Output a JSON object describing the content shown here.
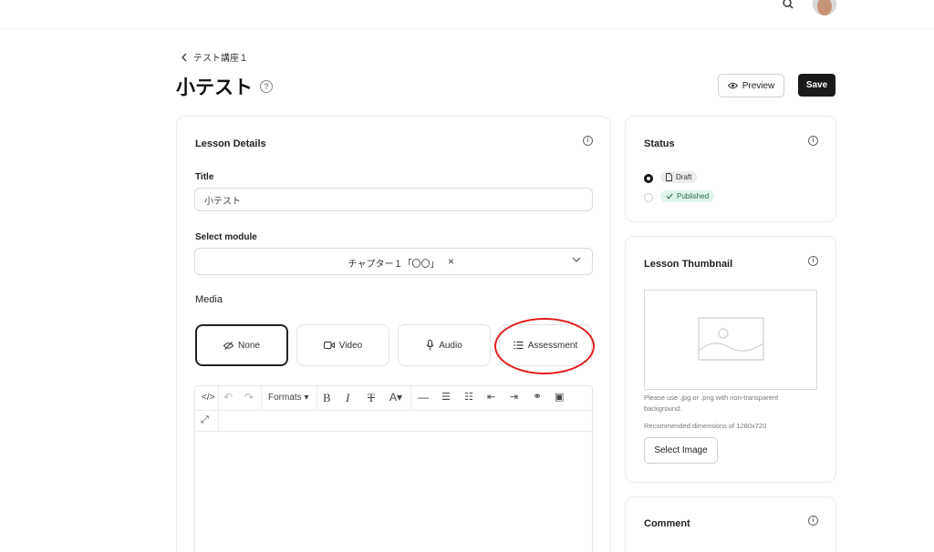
{
  "header": {
    "search_icon": "search-icon",
    "avatar_icon": "user-avatar"
  },
  "breadcrumb": {
    "label": "テスト講座１"
  },
  "page": {
    "title": "小テスト",
    "preview_label": "Preview",
    "save_label": "Save"
  },
  "lesson_details": {
    "heading": "Lesson Details",
    "title_label": "Title",
    "title_value": "小テスト",
    "module_label": "Select module",
    "module_value": "チャプター１「〇〇」",
    "media_label": "Media",
    "media_options": [
      {
        "label": "None",
        "icon": "eye-off-icon",
        "selected": true
      },
      {
        "label": "Video",
        "icon": "video-icon",
        "selected": false
      },
      {
        "label": "Audio",
        "icon": "mic-icon",
        "selected": false
      },
      {
        "label": "Assessment",
        "icon": "list-icon",
        "selected": false
      }
    ],
    "highlight_color": "#e01b1b"
  },
  "editor": {
    "formats_label": "Formats"
  },
  "status": {
    "heading": "Status",
    "options": [
      {
        "label": "Draft",
        "selected": true,
        "color": "#ececec"
      },
      {
        "label": "Published",
        "selected": false,
        "color": "#dff5ea"
      }
    ]
  },
  "thumbnail": {
    "heading": "Lesson Thumbnail",
    "hint": "Please use .jpg or .png with non-transparent background.",
    "dimensions": "Recommended dimensions of 1280x720",
    "button_label": "Select Image"
  },
  "comment": {
    "heading": "Comment"
  }
}
